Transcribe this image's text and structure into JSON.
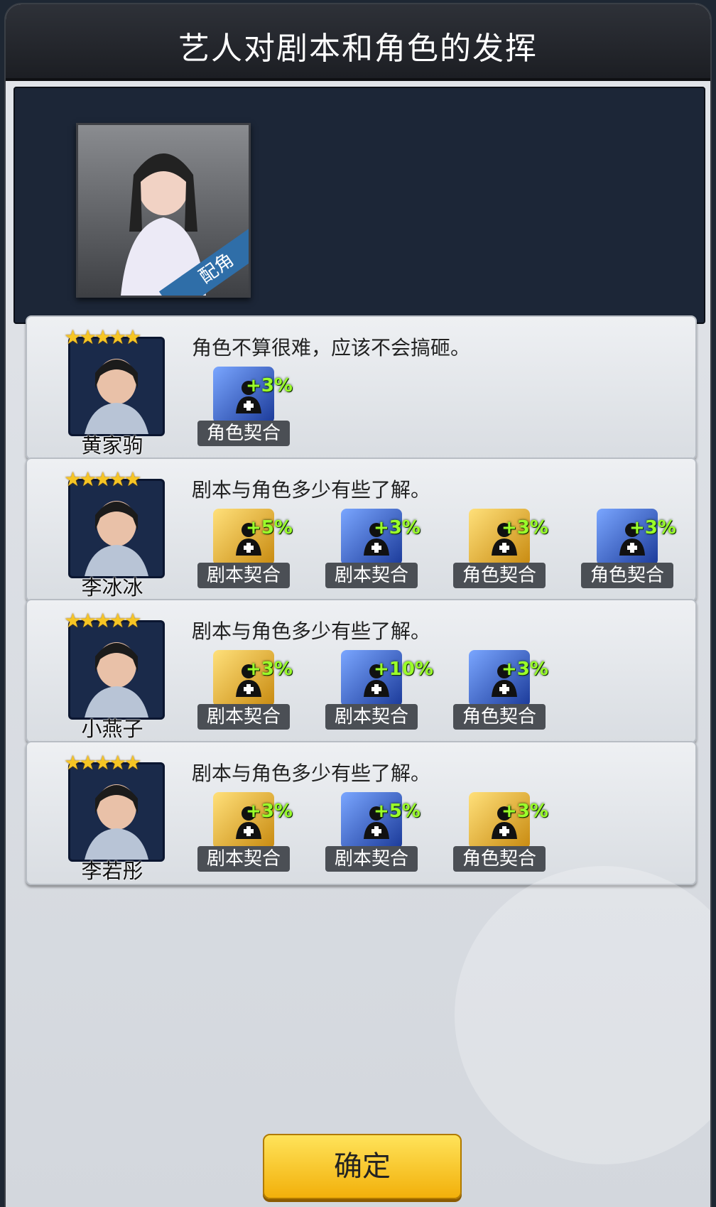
{
  "title": "艺人对剧本和角色的发挥",
  "role": {
    "badge": "配角"
  },
  "rows": [
    {
      "name": "黄家驹",
      "stars": 5,
      "desc": "角色不算很难，应该不会搞砸。",
      "traits": [
        {
          "label": "角色契合",
          "bonus": "+3%",
          "color": "blue"
        }
      ]
    },
    {
      "name": "李冰冰",
      "stars": 5,
      "desc": "剧本与角色多少有些了解。",
      "traits": [
        {
          "label": "剧本契合",
          "bonus": "+5%",
          "color": "gold"
        },
        {
          "label": "剧本契合",
          "bonus": "+3%",
          "color": "blue"
        },
        {
          "label": "角色契合",
          "bonus": "+3%",
          "color": "gold"
        },
        {
          "label": "角色契合",
          "bonus": "+3%",
          "color": "blue"
        }
      ]
    },
    {
      "name": "小燕子",
      "stars": 5,
      "desc": "剧本与角色多少有些了解。",
      "traits": [
        {
          "label": "剧本契合",
          "bonus": "+3%",
          "color": "gold"
        },
        {
          "label": "剧本契合",
          "bonus": "+10%",
          "color": "blue"
        },
        {
          "label": "角色契合",
          "bonus": "+3%",
          "color": "blue"
        }
      ]
    },
    {
      "name": "李若彤",
      "stars": 5,
      "desc": "剧本与角色多少有些了解。",
      "traits": [
        {
          "label": "剧本契合",
          "bonus": "+3%",
          "color": "gold"
        },
        {
          "label": "剧本契合",
          "bonus": "+5%",
          "color": "blue"
        },
        {
          "label": "角色契合",
          "bonus": "+3%",
          "color": "gold"
        }
      ]
    }
  ],
  "confirm_label": "确定",
  "colors": {
    "title_bar": "#26292f",
    "button": "#f6c628",
    "bonus": "#9bff2a"
  }
}
